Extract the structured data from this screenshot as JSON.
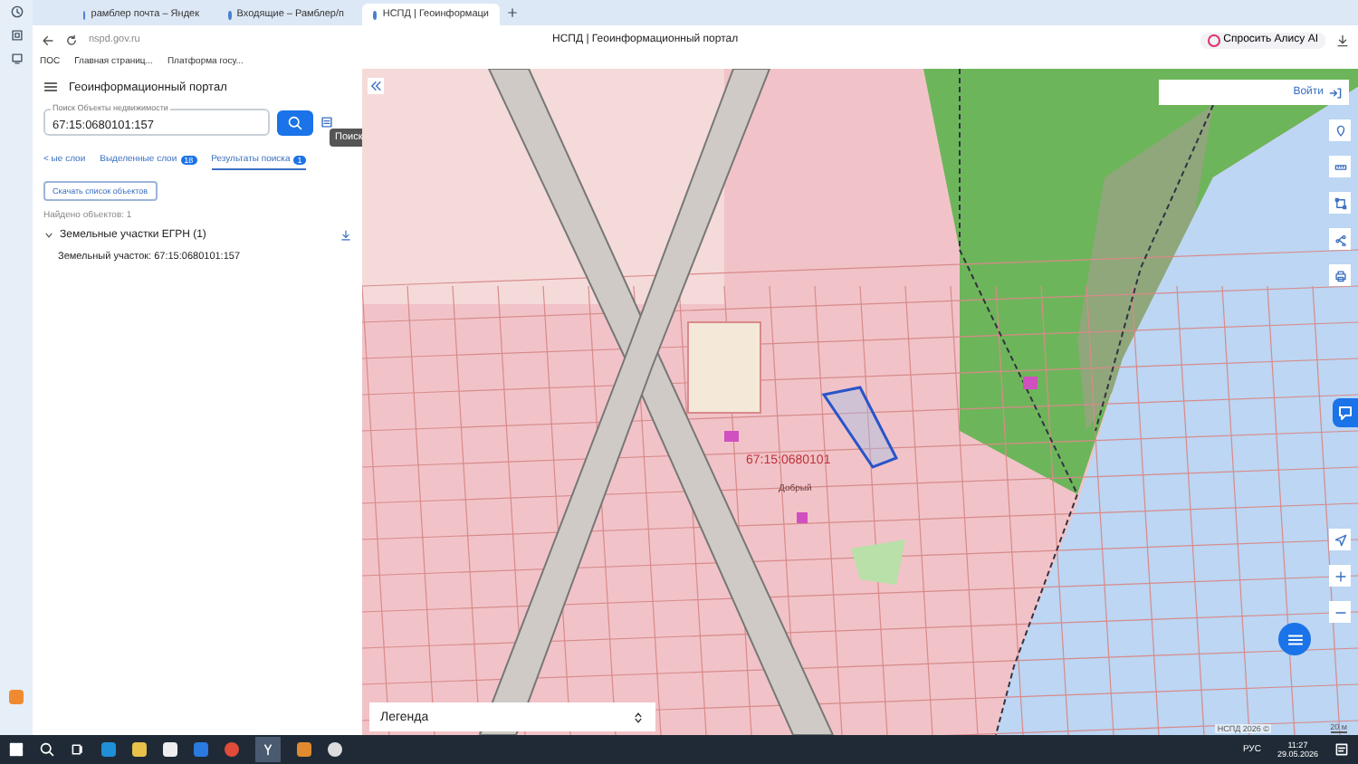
{
  "browser": {
    "tabs": [
      {
        "label": "рамблер почта – Яндек",
        "selected": false
      },
      {
        "label": "Входящие – Рамблер/п",
        "selected": false
      },
      {
        "label": "НСПД | Геоинформаци",
        "selected": true
      }
    ],
    "address": "nspd.gov.ru",
    "page_title": "НСПД | Геоинформационный портал",
    "alice": "Спросить Алису AI",
    "bookmarks": [
      "ПОС",
      "Главная страниц...",
      "Платформа госу..."
    ]
  },
  "sidebar": {
    "title": "Геоинформационный портал",
    "search": {
      "placeholder": "Поиск Объекты недвижимости",
      "value": "67:15:0680101:157"
    },
    "tooltip": "Поиск",
    "tabs": [
      {
        "label": "< ые слои",
        "selected": false
      },
      {
        "label": "Выделенные слои",
        "badge": "18",
        "selected": false
      },
      {
        "label": "Результаты поиска",
        "badge": "1",
        "selected": true
      }
    ],
    "download": "Скачать список объектов",
    "found": "Найдено объектов: 1",
    "group": {
      "label": "Земельные участки ЕГРН (1)",
      "expanded": true
    },
    "result": "Земельный участок: 67:15:0680101:157"
  },
  "map": {
    "login": "Войти",
    "legend": "Легенда",
    "parcel_label": "67:15:0680101",
    "place_label": "Добрый",
    "attribution": "НСПД 2026 ©",
    "scale": "20 м"
  },
  "taskbar": {
    "lang": "РУС",
    "time": "11:27",
    "date": "29.05.2026"
  }
}
